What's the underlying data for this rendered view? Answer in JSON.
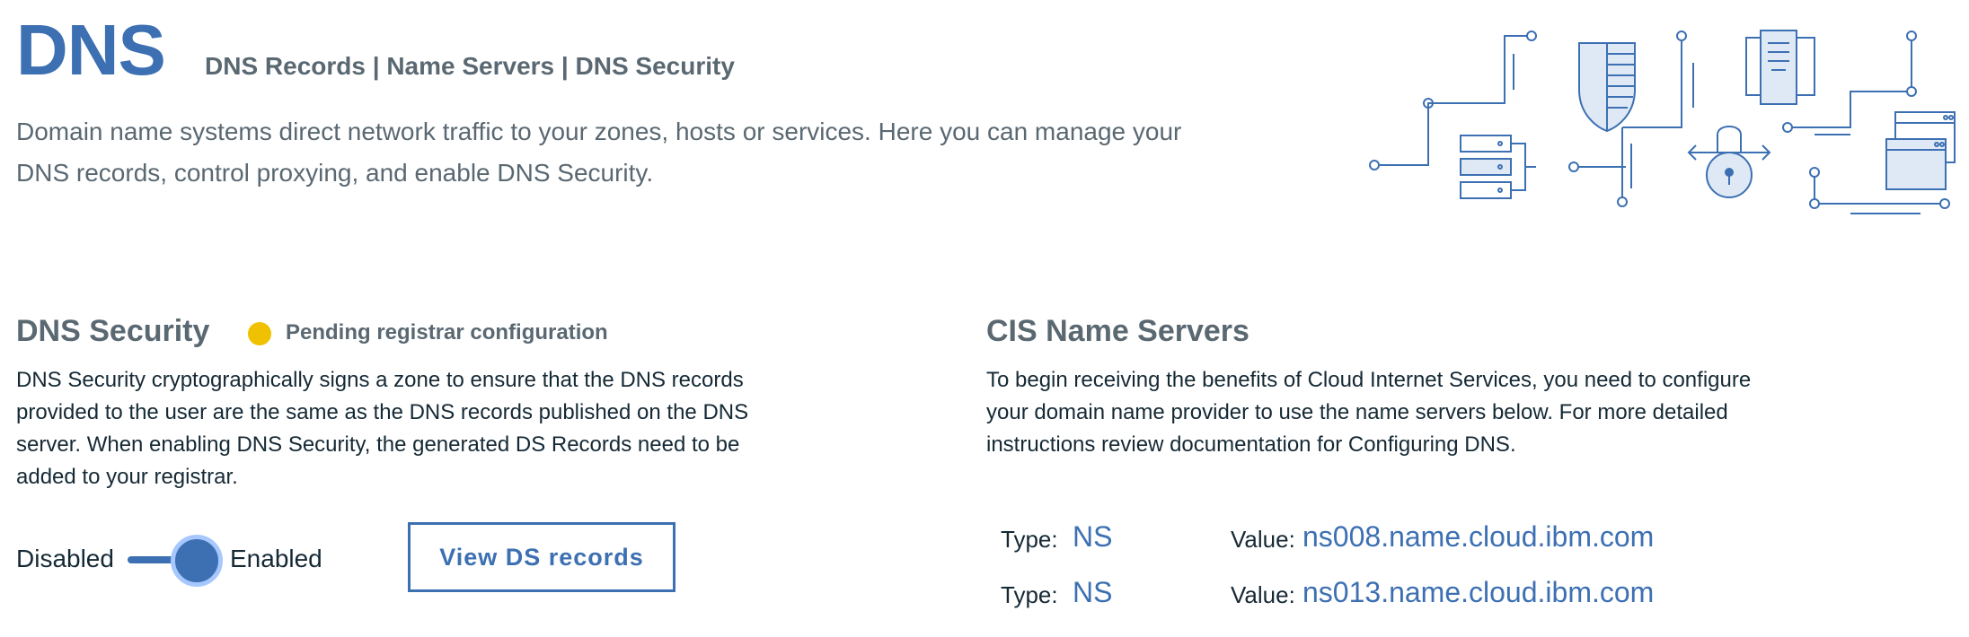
{
  "header": {
    "title": "DNS",
    "nav": "DNS Records | Name Servers | DNS Security",
    "description": "Domain name systems direct network traffic to your zones, hosts or services. Here you can manage your DNS records, control proxying, and enable DNS Security."
  },
  "dns_security": {
    "title": "DNS Security",
    "status": "Pending registrar configuration",
    "status_color": "#efc100",
    "description": "DNS Security cryptographically signs a zone to ensure that the DNS records provided to the user are the same as the DNS records published on the DNS server. When enabling DNS Security, the generated DS Records need to be added to your registrar.",
    "toggle": {
      "off_label": "Disabled",
      "on_label": "Enabled",
      "state": "enabled"
    },
    "view_button": "View DS records"
  },
  "name_servers": {
    "title": "CIS Name Servers",
    "description": "To begin receiving the benefits of Cloud Internet Services, you need to configure your domain name provider to use the name servers below. For more detailed instructions review documentation for Configuring DNS.",
    "type_label": "Type:",
    "value_label": "Value:",
    "rows": [
      {
        "type": "NS",
        "value": "ns008.name.cloud.ibm.com"
      },
      {
        "type": "NS",
        "value": "ns013.name.cloud.ibm.com"
      }
    ]
  },
  "colors": {
    "accent": "#3d70b2",
    "muted_text": "#5a6872",
    "body_text": "#152935"
  },
  "illustration": "network-security-illustration"
}
